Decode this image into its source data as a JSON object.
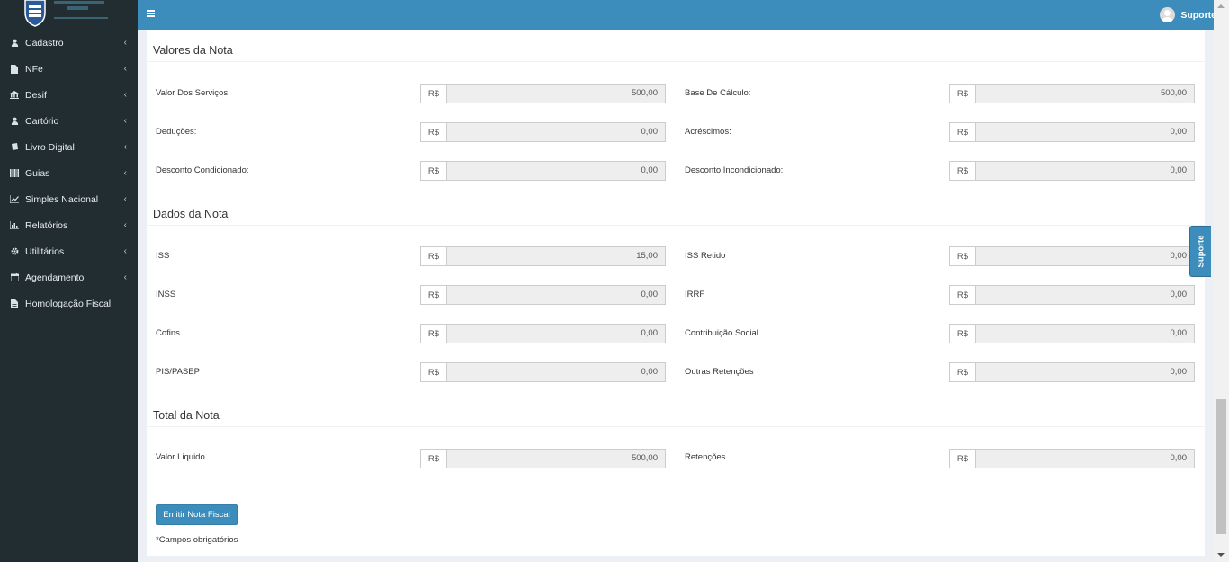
{
  "header": {
    "menu_icon": "hamburger-icon",
    "user_label": "Suporte"
  },
  "sidebar": {
    "items": [
      {
        "label": "Cadastro",
        "icon": "user-icon",
        "has_submenu": true
      },
      {
        "label": "NFe",
        "icon": "file-icon",
        "has_submenu": true
      },
      {
        "label": "Desif",
        "icon": "bank-icon",
        "has_submenu": true
      },
      {
        "label": "Cartório",
        "icon": "user-icon",
        "has_submenu": true
      },
      {
        "label": "Livro Digital",
        "icon": "book-icon",
        "has_submenu": true
      },
      {
        "label": "Guias",
        "icon": "barcode-icon",
        "has_submenu": true
      },
      {
        "label": "Simples Nacional",
        "icon": "line-chart-icon",
        "has_submenu": true
      },
      {
        "label": "Relatórios",
        "icon": "bar-chart-icon",
        "has_submenu": true
      },
      {
        "label": "Utilitários",
        "icon": "gear-icon",
        "has_submenu": true
      },
      {
        "label": "Agendamento",
        "icon": "calendar-icon",
        "has_submenu": true
      },
      {
        "label": "Homologação Fiscal",
        "icon": "file-icon",
        "has_submenu": false
      }
    ]
  },
  "currency_prefix": "R$",
  "sections": {
    "valores": {
      "title": "Valores da Nota",
      "fields": [
        {
          "label": "Valor Dos Serviços:",
          "value": "500,00"
        },
        {
          "label": "Base De Cálculo:",
          "value": "500,00"
        },
        {
          "label": "Deduções:",
          "value": "0,00"
        },
        {
          "label": "Acréscimos:",
          "value": "0,00"
        },
        {
          "label": "Desconto Condicionado:",
          "value": "0,00"
        },
        {
          "label": "Desconto Incondicionado:",
          "value": "0,00"
        }
      ]
    },
    "dados": {
      "title": "Dados da Nota",
      "fields": [
        {
          "label": "ISS",
          "value": "15,00"
        },
        {
          "label": "ISS Retido",
          "value": "0,00"
        },
        {
          "label": "INSS",
          "value": "0,00"
        },
        {
          "label": "IRRF",
          "value": "0,00"
        },
        {
          "label": "Cofins",
          "value": "0,00"
        },
        {
          "label": "Contribuição Social",
          "value": "0,00"
        },
        {
          "label": "PIS/PASEP",
          "value": "0,00"
        },
        {
          "label": "Outras Retenções",
          "value": "0,00"
        }
      ]
    },
    "total": {
      "title": "Total da Nota",
      "fields": [
        {
          "label": "Valor Liquido",
          "value": "500,00"
        },
        {
          "label": "Retenções",
          "value": "0,00"
        }
      ]
    }
  },
  "actions": {
    "emit_label": "Emitir Nota Fiscal",
    "required_note": "*Campos obrigatórios"
  },
  "support_tab": {
    "label": "Suporte"
  }
}
